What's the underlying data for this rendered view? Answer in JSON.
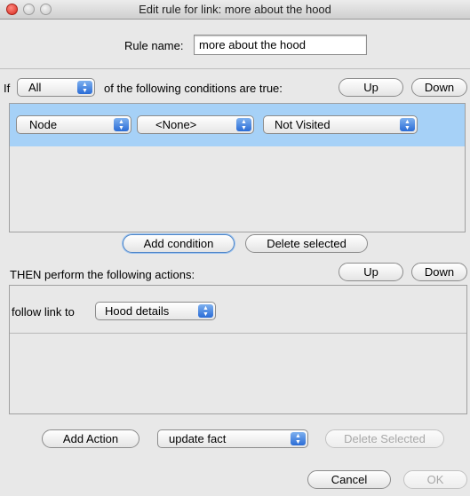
{
  "window": {
    "title": "Edit rule for link: more about the hood"
  },
  "rule_name": {
    "label": "Rule name:",
    "value": "more about the hood"
  },
  "conditions": {
    "if_label": "If",
    "match": "All",
    "suffix": "of the following conditions are true:",
    "up_label": "Up",
    "down_label": "Down",
    "row": {
      "type": "Node",
      "target": "<None>",
      "state": "Not Visited"
    },
    "add_label": "Add condition",
    "delete_label": "Delete selected"
  },
  "actions": {
    "header": "THEN perform the following actions:",
    "up_label": "Up",
    "down_label": "Down",
    "row": {
      "label": "follow link to",
      "target": "Hood details"
    },
    "add_label": "Add Action",
    "action_type": "update fact",
    "delete_label": "Delete Selected"
  },
  "footer": {
    "cancel_label": "Cancel",
    "ok_label": "OK"
  },
  "colors": {
    "selection": "#a6d1f7",
    "accent": "#2a6cd6"
  }
}
